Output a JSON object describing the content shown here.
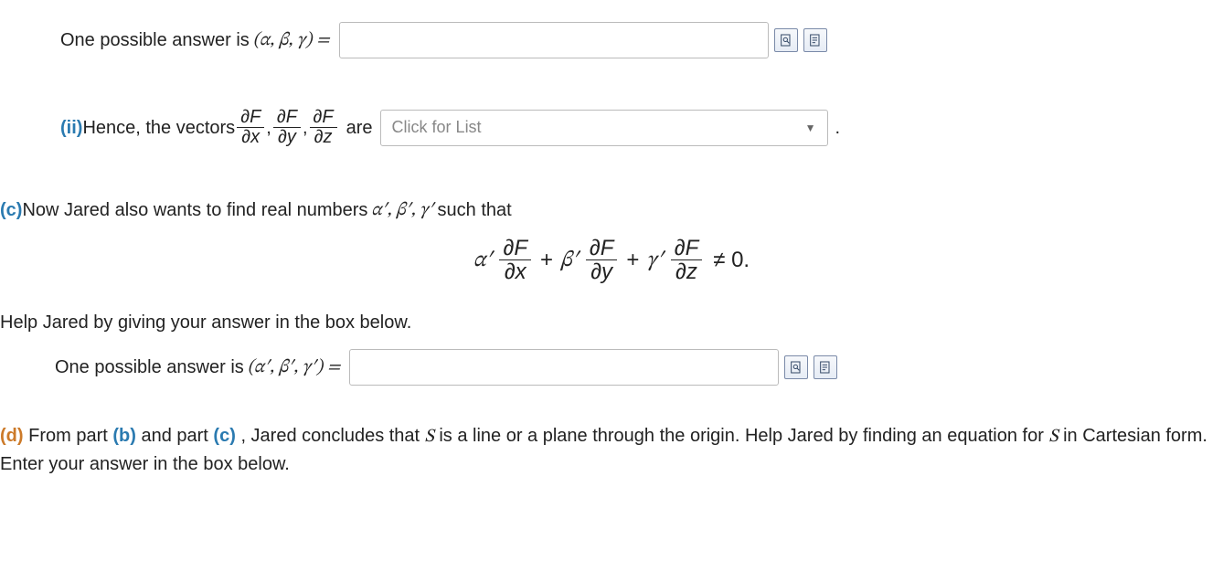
{
  "q_b_i": {
    "prefix": "One possible answer is ",
    "tuple_math": "(α, β, γ) ="
  },
  "q_b_ii": {
    "label": "(ii)",
    "before": " Hence, the vectors ",
    "after_are": " are ",
    "dropdown_placeholder": "Click for List",
    "period": " ."
  },
  "q_c": {
    "label": "(c)",
    "line1_before": "  Now Jared also wants to find real numbers ",
    "line1_math": "α′, β′, γ′",
    "line1_after": " such that",
    "eq_alpha": "α′",
    "eq_beta": "β′",
    "eq_gamma": "γ′",
    "eq_neq": "≠ 0.",
    "help_line": "Help Jared by giving your answer in the box below.",
    "ans_prefix": "One possible answer is ",
    "ans_tuple": "(α′, β′, γ′) ="
  },
  "q_d": {
    "label": "(d)",
    "t1": " From part ",
    "b": "(b)",
    "t2": " and part ",
    "c": "(c)",
    "t3": ", Jared concludes that ",
    "S": "S",
    "t4": " is a line or a plane through the origin. Help Jared by finding an equation for ",
    "t5": " in Cartesian form. Enter your answer in the box below."
  },
  "frac": {
    "dF": "∂F",
    "dx": "∂x",
    "dy": "∂y",
    "dz": "∂z"
  }
}
